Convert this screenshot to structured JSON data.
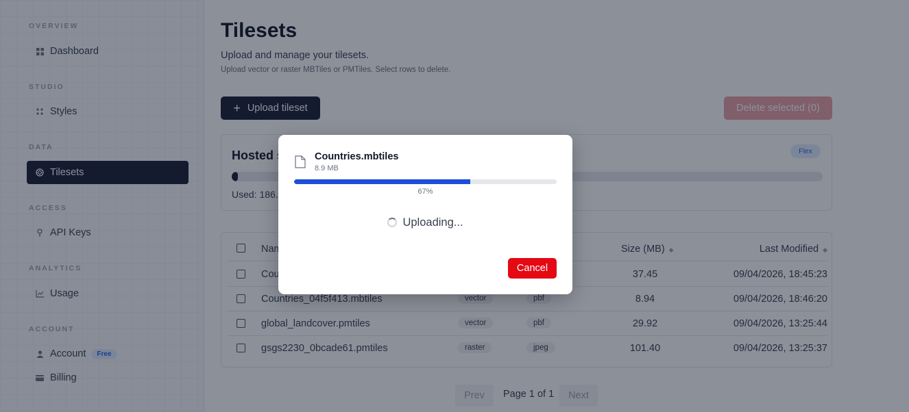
{
  "sidebar": {
    "sections": [
      {
        "label": "OVERVIEW",
        "items": [
          {
            "label": "Dashboard",
            "icon": "grid-icon"
          }
        ]
      },
      {
        "label": "STUDIO",
        "items": [
          {
            "label": "Styles",
            "icon": "dots-grid-icon"
          }
        ]
      },
      {
        "label": "DATA",
        "items": [
          {
            "label": "Tilesets",
            "icon": "layers-icon",
            "active": true
          }
        ]
      },
      {
        "label": "ACCESS",
        "items": [
          {
            "label": "API Keys",
            "icon": "key-icon"
          }
        ]
      },
      {
        "label": "ANALYTICS",
        "items": [
          {
            "label": "Usage",
            "icon": "chart-icon"
          }
        ]
      },
      {
        "label": "ACCOUNT",
        "items": [
          {
            "label": "Account",
            "icon": "user-icon",
            "badge": "Free"
          },
          {
            "label": "Billing",
            "icon": "card-icon"
          }
        ]
      }
    ]
  },
  "page": {
    "title": "Tilesets",
    "subtitle": "Upload and manage your tilesets.",
    "hint": "Upload vector or raster MBTiles or PMTiles. Select rows to delete.",
    "upload_label": "Upload tileset",
    "delete_label": "Delete selected (0)"
  },
  "storage": {
    "title": "Hosted s",
    "plan_badge": "Flex",
    "used_text": "Used: 186.7",
    "used_fraction": 0.01
  },
  "table": {
    "headers": {
      "name": "Nam",
      "size": "Size (MB)",
      "modified": "Last Modified"
    },
    "rows": [
      {
        "name": "Cou",
        "type": "",
        "format": "",
        "size": "37.45",
        "modified": "09/04/2026, 18:45:23"
      },
      {
        "name": "Countries_04f5f413.mbtiles",
        "type": "vector",
        "format": "pbf",
        "size": "8.94",
        "modified": "09/04/2026, 18:46:20"
      },
      {
        "name": "global_landcover.pmtiles",
        "type": "vector",
        "format": "pbf",
        "size": "29.92",
        "modified": "09/04/2026, 13:25:44"
      },
      {
        "name": "gsgs2230_0bcade61.pmtiles",
        "type": "raster",
        "format": "jpeg",
        "size": "101.40",
        "modified": "09/04/2026, 13:25:37"
      }
    ]
  },
  "pagination": {
    "prev": "Prev",
    "page_text": "Page 1 of 1",
    "next": "Next"
  },
  "modal": {
    "file_name": "Countries.mbtiles",
    "file_size": "8.9 MB",
    "progress_percent": 67,
    "progress_label": "67%",
    "status": "Uploading...",
    "cancel_label": "Cancel"
  },
  "colors": {
    "brand_dark": "#1a2035",
    "progress_blue": "#1d4ed8",
    "cancel_red": "#e50914"
  }
}
